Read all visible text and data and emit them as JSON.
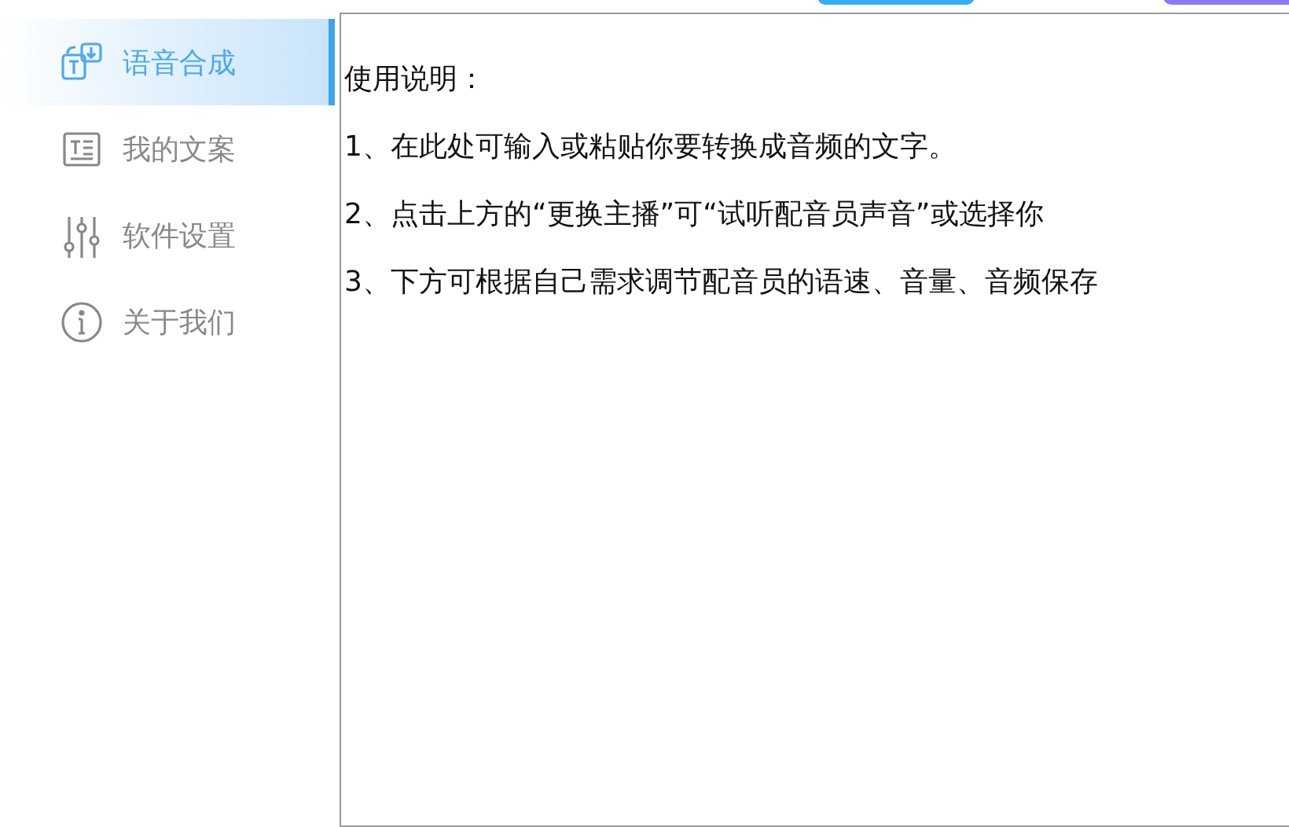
{
  "sidebar": {
    "items": [
      {
        "label": "语音合成",
        "kind": "synthesis",
        "selected": true
      },
      {
        "label": "我的文案",
        "kind": "document",
        "selected": false
      },
      {
        "label": "软件设置",
        "kind": "sliders",
        "selected": false
      },
      {
        "label": "关于我们",
        "kind": "info",
        "selected": false
      }
    ]
  },
  "editor": {
    "lines": [
      "使用说明：",
      "1、在此处可输入或粘贴你要转换成音频的文字。",
      "2、点击上方的“更换主播”可“试听配音员声音”或选择你",
      "3、下方可根据自己需求调节配音员的语速、音量、音频保存"
    ]
  }
}
